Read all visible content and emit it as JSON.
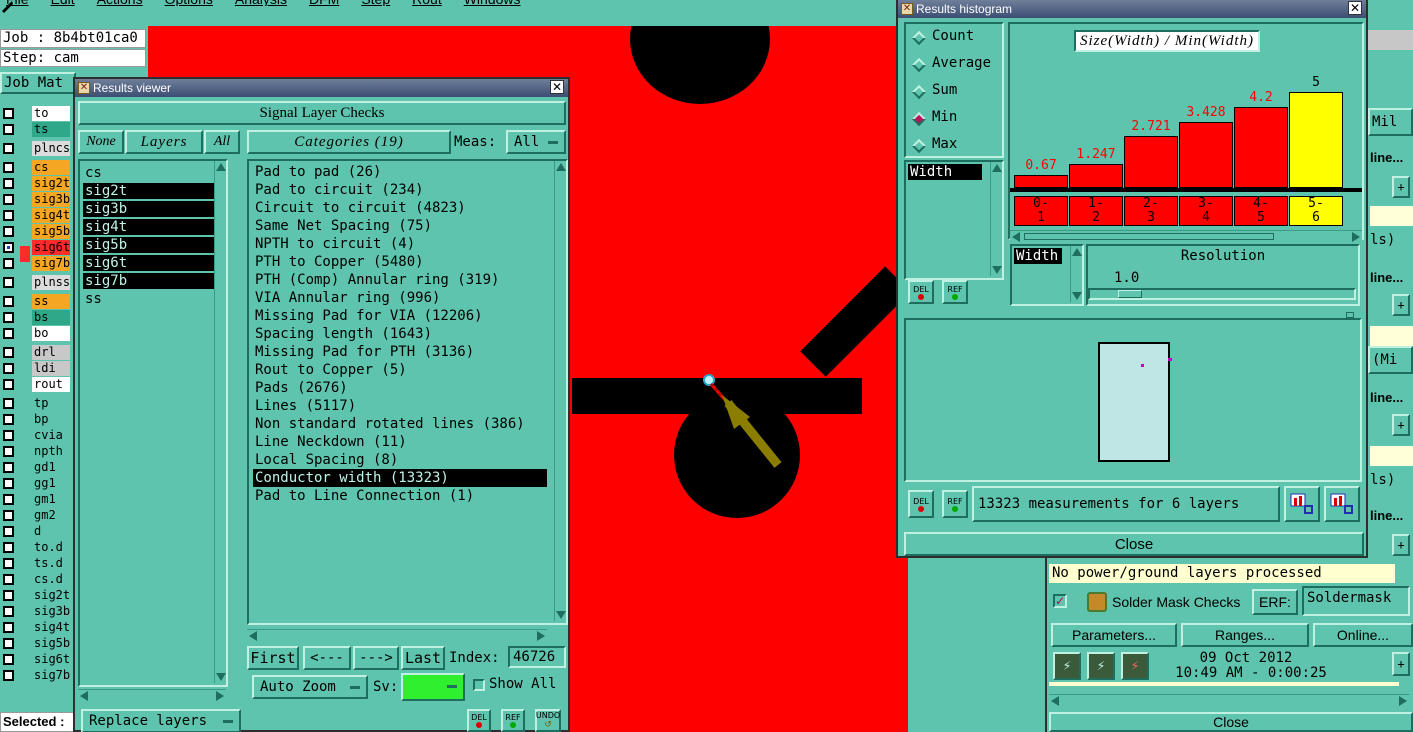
{
  "menubar": [
    "File",
    "Edit",
    "Actions",
    "Options",
    "Analysis",
    "DFM",
    "Step",
    "Rout",
    "Windows"
  ],
  "job_label": "Job : 8b4bt01ca0",
  "step_label": "Step: cam",
  "job_matrix_label": "Job Mat",
  "selected_label": "Selected :",
  "layers": [
    {
      "name": "to",
      "color": "#ffffff",
      "checked": false
    },
    {
      "name": "ts",
      "color": "#2fa889",
      "checked": false
    },
    {
      "name": "plncs",
      "color": "#dcdcdc",
      "checked": false
    },
    {
      "name": "cs",
      "color": "#f5a623",
      "checked": false
    },
    {
      "name": "sig2t",
      "color": "#f5a623",
      "checked": false
    },
    {
      "name": "sig3b",
      "color": "#f5a623",
      "checked": false
    },
    {
      "name": "sig4t",
      "color": "#f5a623",
      "checked": false
    },
    {
      "name": "sig5b",
      "color": "#f5a623",
      "checked": false
    },
    {
      "name": "sig6t",
      "color": "#ff2a2a",
      "checked": true
    },
    {
      "name": "sig7b",
      "color": "#f5a623",
      "checked": false
    },
    {
      "name": "plnss",
      "color": "#dcdcdc",
      "checked": false
    },
    {
      "name": "ss",
      "color": "#f5a623",
      "checked": false
    },
    {
      "name": "bs",
      "color": "#2fa889",
      "checked": false
    },
    {
      "name": "bo",
      "color": "#ffffff",
      "checked": false
    },
    {
      "name": "drl",
      "color": "#c8c8c8",
      "checked": false
    },
    {
      "name": "ldi",
      "color": "#c8c8c8",
      "checked": false
    },
    {
      "name": "rout",
      "color": "#ffffff",
      "checked": false
    },
    {
      "name": "tp",
      "color": "#5fc4ad",
      "checked": false
    },
    {
      "name": "bp",
      "color": "#5fc4ad",
      "checked": false
    },
    {
      "name": "cvia",
      "color": "#5fc4ad",
      "checked": false
    },
    {
      "name": "npth",
      "color": "#5fc4ad",
      "checked": false
    },
    {
      "name": "gd1",
      "color": "#5fc4ad",
      "checked": false
    },
    {
      "name": "gg1",
      "color": "#5fc4ad",
      "checked": false
    },
    {
      "name": "gm1",
      "color": "#5fc4ad",
      "checked": false
    },
    {
      "name": "gm2",
      "color": "#5fc4ad",
      "checked": false
    },
    {
      "name": "d",
      "color": "#5fc4ad",
      "checked": false
    },
    {
      "name": "to.d",
      "color": "#5fc4ad",
      "checked": false
    },
    {
      "name": "ts.d",
      "color": "#5fc4ad",
      "checked": false
    },
    {
      "name": "cs.d",
      "color": "#5fc4ad",
      "checked": false
    },
    {
      "name": "sig2t",
      "color": "#5fc4ad",
      "checked": false
    },
    {
      "name": "sig3b",
      "color": "#5fc4ad",
      "checked": false
    },
    {
      "name": "sig4t",
      "color": "#5fc4ad",
      "checked": false
    },
    {
      "name": "sig5b",
      "color": "#5fc4ad",
      "checked": false
    },
    {
      "name": "sig6t",
      "color": "#5fc4ad",
      "checked": false
    },
    {
      "name": "sig7b",
      "color": "#5fc4ad",
      "checked": false
    }
  ],
  "viewer": {
    "title": "Results viewer",
    "header": "Signal Layer Checks",
    "none": "None",
    "layers": "Layers",
    "all": "All",
    "categories_label": "Categories (19)",
    "meas_label": "Meas:",
    "meas_value": "All",
    "layer_list": [
      {
        "name": "cs",
        "selected": false
      },
      {
        "name": "sig2t",
        "selected": true
      },
      {
        "name": "sig3b",
        "selected": true
      },
      {
        "name": "sig4t",
        "selected": true
      },
      {
        "name": "sig5b",
        "selected": true
      },
      {
        "name": "sig6t",
        "selected": true
      },
      {
        "name": "sig7b",
        "selected": true
      },
      {
        "name": "ss",
        "selected": false
      }
    ],
    "categories": [
      {
        "label": "Pad to pad (26)",
        "selected": false
      },
      {
        "label": "Pad to circuit (234)",
        "selected": false
      },
      {
        "label": "Circuit to circuit (4823)",
        "selected": false
      },
      {
        "label": "Same Net Spacing (75)",
        "selected": false
      },
      {
        "label": "NPTH to circuit (4)",
        "selected": false
      },
      {
        "label": "PTH to Copper (5480)",
        "selected": false
      },
      {
        "label": "PTH (Comp) Annular ring (319)",
        "selected": false
      },
      {
        "label": "VIA Annular ring (996)",
        "selected": false
      },
      {
        "label": "Missing Pad for VIA (12206)",
        "selected": false
      },
      {
        "label": "Spacing length (1643)",
        "selected": false
      },
      {
        "label": "Missing Pad for PTH (3136)",
        "selected": false
      },
      {
        "label": "Rout to Copper (5)",
        "selected": false
      },
      {
        "label": "Pads (2676)",
        "selected": false
      },
      {
        "label": "Lines (5117)",
        "selected": false
      },
      {
        "label": "Non standard rotated lines (386)",
        "selected": false
      },
      {
        "label": "Line Neckdown (11)",
        "selected": false
      },
      {
        "label": "Local Spacing (8)",
        "selected": false
      },
      {
        "label": "Conductor width (13323)",
        "selected": true
      },
      {
        "label": "Pad to Line Connection (1)",
        "selected": false
      }
    ],
    "first": "First",
    "prev": "<---",
    "next": "--->",
    "last": "Last",
    "index_label": "Index:",
    "index_value": "46726",
    "auto_zoom": "Auto Zoom",
    "sv_label": "Sv:",
    "show_all": "Show All",
    "replace_layers": "Replace layers",
    "del": "DEL",
    "ref": "REF",
    "undo": "UNDO"
  },
  "histogram": {
    "title": "Results histogram",
    "modes": [
      {
        "label": "Count",
        "selected": false
      },
      {
        "label": "Average",
        "selected": false
      },
      {
        "label": "Sum",
        "selected": false
      },
      {
        "label": "Min",
        "selected": true
      },
      {
        "label": "Max",
        "selected": false
      }
    ],
    "width_item": "Width",
    "chart_title": "Size(Width) / Min(Width)",
    "resolution_label": "Resolution",
    "resolution_value": "1.0",
    "width_item2": "Width",
    "measurements": "13323 measurements for 6 layers",
    "close": "Close",
    "del": "DEL",
    "ref": "REF"
  },
  "chart_data": {
    "type": "bar",
    "title": "Size(Width) / Min(Width)",
    "categories": [
      "0-1",
      "1-2",
      "2-3",
      "3-4",
      "4-5",
      "5-6"
    ],
    "values": [
      0.67,
      1.247,
      2.721,
      3.428,
      4.2,
      5
    ],
    "value_labels": [
      "0.67",
      "1.247",
      "2.721",
      "3.428",
      "4.2",
      "5"
    ],
    "bin_labels": [
      [
        "0-",
        "1"
      ],
      [
        "1-",
        "2"
      ],
      [
        "2-",
        "3"
      ],
      [
        "3-",
        "4"
      ],
      [
        "4-",
        "5"
      ],
      [
        "5-",
        "6"
      ]
    ],
    "ylim": [
      0,
      5.2
    ],
    "colors": [
      "#ff0000",
      "#ff0000",
      "#ff0000",
      "#ff0000",
      "#ff0000",
      "#ffff00"
    ]
  },
  "right_panel": {
    "mil": "Mil",
    "online_short": "line...",
    "ls": "ls)",
    "mi": "(Mi",
    "no_power": "No power/ground layers processed",
    "solder_mask": "Solder Mask Checks",
    "erf": "ERF:",
    "erf_value": "Soldermask",
    "parameters": "Parameters...",
    "ranges": "Ranges...",
    "online": "Online...",
    "date": "09 Oct 2012",
    "time": "10:49 AM - 0:00:25",
    "close": "Close"
  }
}
